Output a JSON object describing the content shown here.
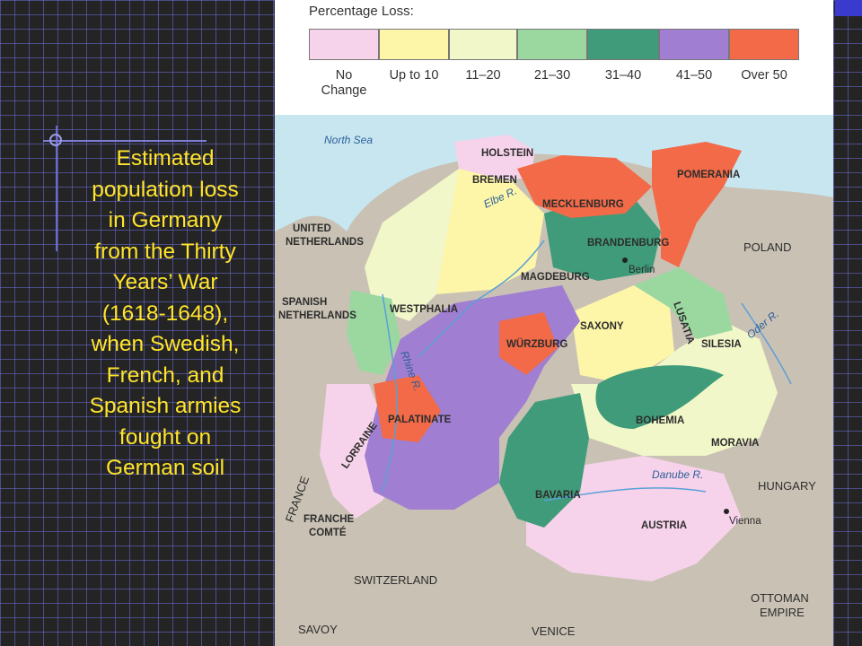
{
  "caption": {
    "lines": [
      "Estimated",
      "population loss",
      "in Germany",
      "from the Thirty",
      "Years’ War",
      "(1618-1648),",
      "when Swedish,",
      "French, and",
      "Spanish armies",
      "fought on",
      "German soil"
    ]
  },
  "legend": {
    "title": "Percentage Loss:",
    "items": [
      {
        "label1": "No",
        "label2": "Change",
        "color": "#f6d3ea"
      },
      {
        "label1": "Up to 10",
        "label2": "",
        "color": "#fdf6a8"
      },
      {
        "label1": "11–20",
        "label2": "",
        "color": "#f1f7c9"
      },
      {
        "label1": "21–30",
        "label2": "",
        "color": "#9ad8a0"
      },
      {
        "label1": "31–40",
        "label2": "",
        "color": "#3f9b79"
      },
      {
        "label1": "41–50",
        "label2": "",
        "color": "#a07ed1"
      },
      {
        "label1": "Over 50",
        "label2": "",
        "color": "#f26a47"
      }
    ]
  },
  "map": {
    "regions": {
      "holstein": "HOLSTEIN",
      "bremen": "BREMEN",
      "mecklenburg": "MECKLENBURG",
      "pomerania": "POMERANIA",
      "poland": "POLAND",
      "united_netherlands_1": "UNITED",
      "united_netherlands_2": "NETHERLANDS",
      "brandenburg": "BRANDENBURG",
      "magdeburg": "MAGDEBURG",
      "spanish_netherlands_1": "SPANISH",
      "spanish_netherlands_2": "NETHERLANDS",
      "westphalia": "WESTPHALIA",
      "saxony": "SAXONY",
      "lusatia": "LUSATIA",
      "silesia": "SILESIA",
      "wurzburg": "WÜRZBURG",
      "palatinate": "PALATINATE",
      "bohemia": "BOHEMIA",
      "lorraine": "LORRAINE",
      "moravia": "MORAVIA",
      "france": "FRANCE",
      "bavaria": "BAVARIA",
      "hungary": "HUNGARY",
      "franche_comte_1": "FRANCHE",
      "franche_comte_2": "COMTÉ",
      "austria": "AUSTRIA",
      "switzerland": "SWITZERLAND",
      "ottoman_1": "OTTOMAN",
      "ottoman_2": "EMPIRE",
      "savoy": "SAVOY",
      "venice": "VENICE"
    },
    "cities": {
      "berlin": "Berlin",
      "vienna": "Vienna"
    },
    "water": {
      "north_sea": "North Sea",
      "elbe": "Elbe R.",
      "rhine": "Rhine R.",
      "oder": "Oder R.",
      "danube": "Danube R."
    }
  }
}
